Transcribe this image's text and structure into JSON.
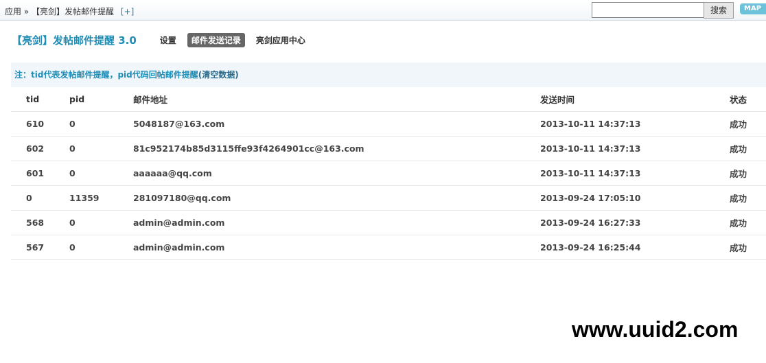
{
  "breadcrumb": {
    "root": "应用",
    "sep": "»",
    "current": "【亮剑】发帖邮件提醒",
    "plus": "[+]"
  },
  "search": {
    "value": "",
    "button": "搜索",
    "map": "MAP"
  },
  "header": {
    "title": "【亮剑】发帖邮件提醒 3.0",
    "nav": [
      {
        "label": "设置",
        "active": false
      },
      {
        "label": "邮件发送记录",
        "active": true
      },
      {
        "label": "亮剑应用中心",
        "active": false
      }
    ]
  },
  "note": {
    "text": "注：tid代表发帖邮件提醒，pid代码回帖邮件提醒",
    "link": "(清空数据)"
  },
  "table": {
    "headers": [
      "tid",
      "pid",
      "邮件地址",
      "发送时间",
      "状态"
    ],
    "rows": [
      [
        "610",
        "0",
        "5048187@163.com",
        "2013-10-11 14:37:13",
        "成功"
      ],
      [
        "602",
        "0",
        "81c952174b85d3115ffe93f4264901cc@163.com",
        "2013-10-11 14:37:13",
        "成功"
      ],
      [
        "601",
        "0",
        "aaaaaa@qq.com",
        "2013-10-11 14:37:13",
        "成功"
      ],
      [
        "0",
        "11359",
        "281097180@qq.com",
        "2013-09-24 17:05:10",
        "成功"
      ],
      [
        "568",
        "0",
        "admin@admin.com",
        "2013-09-24 16:27:33",
        "成功"
      ],
      [
        "567",
        "0",
        "admin@admin.com",
        "2013-09-24 16:25:44",
        "成功"
      ]
    ]
  },
  "watermark": "www.uuid2.com"
}
